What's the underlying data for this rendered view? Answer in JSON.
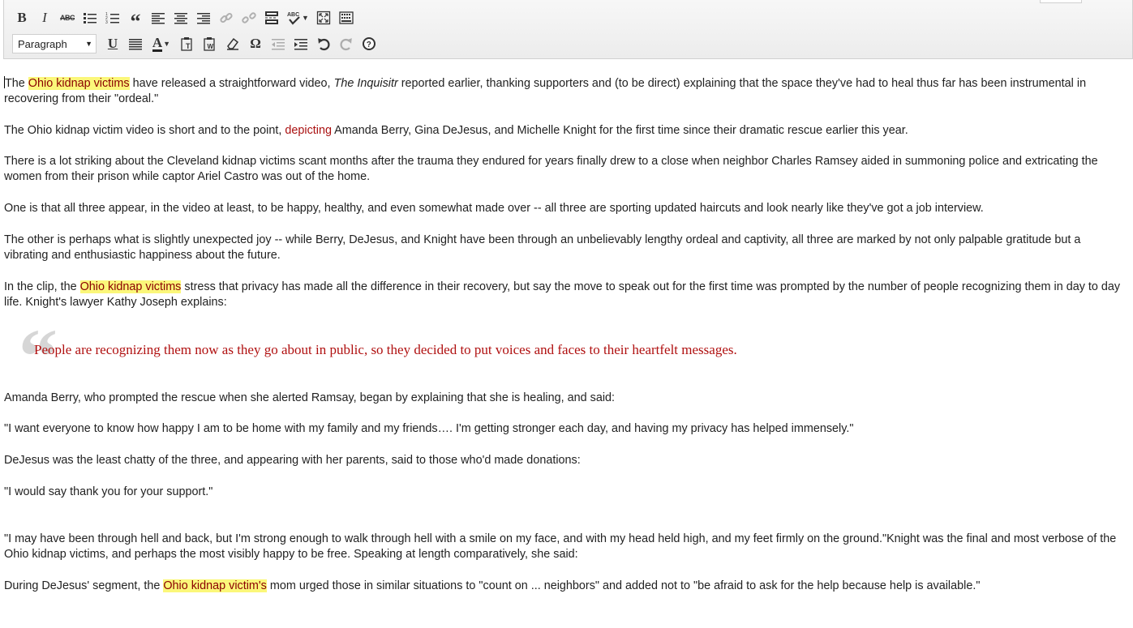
{
  "toolbar": {
    "row1": [
      {
        "name": "bold-button",
        "label": "B",
        "kind": "txt"
      },
      {
        "name": "italic-button",
        "label": "I",
        "kind": "it"
      },
      {
        "name": "strikethrough-button",
        "label": "ABC",
        "kind": "abc"
      },
      {
        "name": "bullet-list-button",
        "icon": "bullet-list-icon"
      },
      {
        "name": "numbered-list-button",
        "icon": "numbered-list-icon"
      },
      {
        "name": "blockquote-button",
        "label": "“",
        "kind": "quote"
      },
      {
        "name": "align-left-button",
        "icon": "align-left-icon"
      },
      {
        "name": "align-center-button",
        "icon": "align-center-icon"
      },
      {
        "name": "align-right-button",
        "icon": "align-right-icon"
      },
      {
        "name": "insert-link-button",
        "icon": "link-icon",
        "disabled": true
      },
      {
        "name": "remove-link-button",
        "icon": "unlink-icon",
        "disabled": true
      },
      {
        "name": "insert-more-tag-button",
        "icon": "more-tag-icon"
      },
      {
        "name": "spellcheck-button",
        "icon": "spellcheck-icon",
        "dropdown": true
      },
      {
        "name": "fullscreen-button",
        "icon": "fullscreen-icon"
      },
      {
        "name": "kitchen-sink-button",
        "icon": "kitchen-sink-icon"
      }
    ],
    "format_select": "Paragraph",
    "row2": [
      {
        "name": "underline-button",
        "label": "U",
        "kind": "txt",
        "underline": true
      },
      {
        "name": "justify-button",
        "icon": "justify-icon"
      },
      {
        "name": "text-color-button",
        "label": "A",
        "kind": "txt",
        "dropdown": true,
        "underline_color": "#222222"
      },
      {
        "name": "paste-text-button",
        "icon": "paste-text-icon"
      },
      {
        "name": "paste-word-button",
        "icon": "paste-word-icon"
      },
      {
        "name": "clear-formatting-button",
        "icon": "eraser-icon"
      },
      {
        "name": "special-character-button",
        "label": "Ω",
        "kind": "txt"
      },
      {
        "name": "outdent-button",
        "icon": "outdent-icon",
        "disabled": true
      },
      {
        "name": "indent-button",
        "icon": "indent-icon"
      },
      {
        "name": "undo-button",
        "icon": "undo-icon"
      },
      {
        "name": "redo-button",
        "icon": "redo-icon",
        "disabled": true
      },
      {
        "name": "help-button",
        "icon": "help-icon"
      }
    ]
  },
  "content": {
    "p1": {
      "a": "The ",
      "hl": "Ohio kidnap victims",
      "b": " have released a straightforward video, ",
      "em": "The Inquisitr",
      "c": " reported earlier, thanking supporters and (to be direct) explaining that the space they've had to heal thus far has been instrumental in recovering from their \"ordeal.\""
    },
    "p2": {
      "a": "The Ohio kidnap victim video is short and to the point, ",
      "red": "depicting",
      "b": " Amanda Berry, Gina DeJesus, and Michelle Knight for the first time since their dramatic rescue earlier this year."
    },
    "p3": "There is a lot striking about the Cleveland kidnap victims scant months after the trauma they endured for years finally drew to a close when neighbor Charles Ramsey aided in summoning police and extricating the women from their prison while captor Ariel Castro was out of the home.",
    "p4": "One is that all three appear, in the video at least, to be happy, healthy, and even somewhat made over -- all three are sporting updated haircuts and look nearly like they've got a job interview.",
    "p5": "The other is perhaps what is slightly unexpected joy -- while Berry, DeJesus, and Knight have been through an unbelievably lengthy ordeal and captivity, all three are marked by not only palpable gratitude but a vibrating and enthusiastic happiness about the future.",
    "p6": {
      "a": "In the clip, the ",
      "hl": "Ohio kidnap victims",
      "b": " stress that privacy has made all the difference in their recovery, but say the move to speak out for the first time was prompted by the number of people recognizing them in day to day life. Knight's lawyer Kathy Joseph explains:"
    },
    "blockquote": "People are recognizing them now as they go about in public, so they decided to put voices and faces to their heartfelt messages.",
    "p7": "Amanda Berry, who prompted the rescue when she alerted Ramsay, began by explaining that she is healing, and said:",
    "p8": "\"I want everyone to know how happy I am to be home with my family and my friends…. I'm getting stronger each day, and having my privacy has helped immensely.\"",
    "p9": "DeJesus was the least chatty of the three, and appearing with her parents, said to those who'd made donations:",
    "p10": "\"I would say thank you for your support.\"",
    "p11": "\"I may have been through hell and back, but I'm strong enough to walk through hell with a smile on my face, and with my head held high, and my feet firmly on the ground.\"Knight was the final and most verbose of the Ohio kidnap victims, and perhaps the most visibly happy to be free. Speaking at length comparatively, she said:",
    "p12": {
      "a": "During DeJesus' segment, the ",
      "hl": "Ohio kidnap victim's",
      "b": " mom urged those in similar situations to \"count on ... neighbors\" and added not to \"be afraid to ask for the help because help is available.\""
    }
  },
  "colors": {
    "highlight": "#fbf77a",
    "link_red": "#aa1111",
    "quote_red": "#b01010"
  }
}
